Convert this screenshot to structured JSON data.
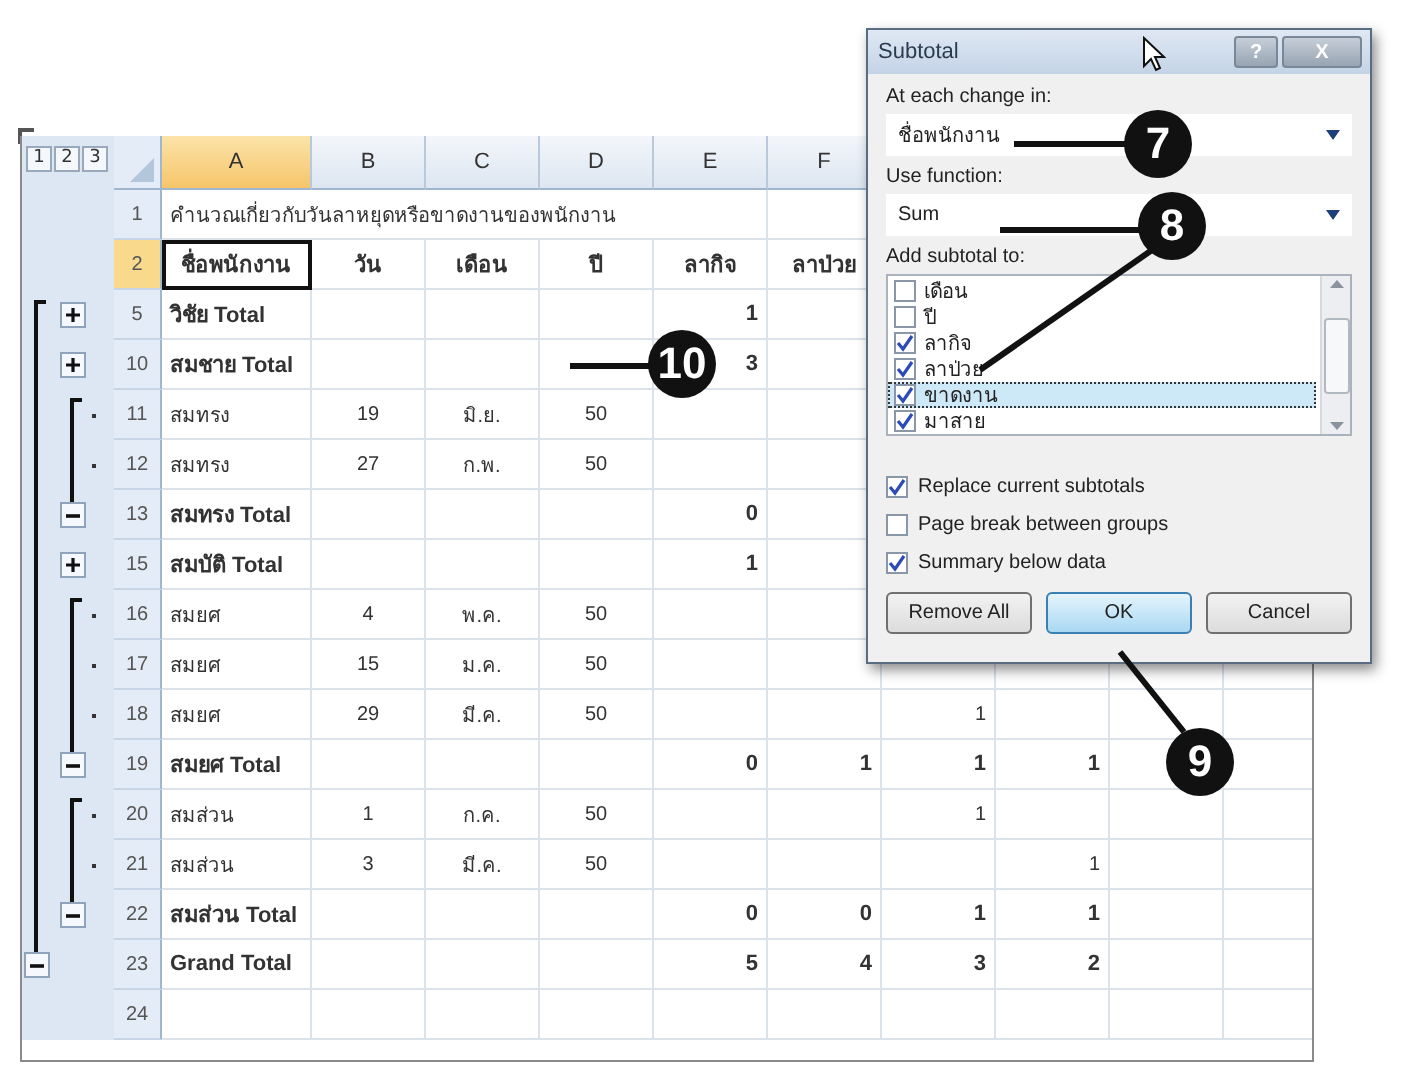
{
  "outline_levels": [
    "1",
    "2",
    "3"
  ],
  "columns": [
    {
      "label": "A",
      "selected": true
    },
    {
      "label": "B",
      "selected": false
    },
    {
      "label": "C",
      "selected": false
    },
    {
      "label": "D",
      "selected": false
    },
    {
      "label": "E",
      "selected": false
    },
    {
      "label": "F",
      "selected": false
    }
  ],
  "rows": [
    {
      "number": "1",
      "kind": "title",
      "selected": false,
      "cells": [
        "คำนวณเกี่ยวกับวันลาหยุดหรือขาดงานของพนักงาน"
      ]
    },
    {
      "number": "2",
      "kind": "header",
      "selected": true,
      "cells": [
        "ชื่อพนักงาน",
        "วัน",
        "เดือน",
        "ปี",
        "ลากิจ",
        "ลาป่วย"
      ]
    },
    {
      "number": "5",
      "kind": "total",
      "selected": false,
      "outline": {
        "kind": "expand"
      },
      "cells": [
        "วิชัย Total",
        null,
        null,
        null,
        "1"
      ]
    },
    {
      "number": "10",
      "kind": "total",
      "selected": false,
      "outline": {
        "kind": "expand"
      },
      "cells": [
        "สมชาย Total",
        null,
        null,
        null,
        "3"
      ]
    },
    {
      "number": "11",
      "kind": "detail",
      "selected": false,
      "outline": {
        "kind": "detail"
      },
      "cells": [
        "สมทรง",
        "19",
        "มิ.ย.",
        "50"
      ]
    },
    {
      "number": "12",
      "kind": "detail",
      "selected": false,
      "outline": {
        "kind": "detail"
      },
      "cells": [
        "สมทรง",
        "27",
        "ก.พ.",
        "50"
      ]
    },
    {
      "number": "13",
      "kind": "total",
      "selected": false,
      "outline": {
        "kind": "collapse"
      },
      "cells": [
        "สมทรง Total",
        null,
        null,
        null,
        "0"
      ]
    },
    {
      "number": "15",
      "kind": "total",
      "selected": false,
      "outline": {
        "kind": "expand"
      },
      "cells": [
        "สมบัติ Total",
        null,
        null,
        null,
        "1"
      ]
    },
    {
      "number": "16",
      "kind": "detail",
      "selected": false,
      "outline": {
        "kind": "detail"
      },
      "cells": [
        "สมยศ",
        "4",
        "พ.ค.",
        "50"
      ]
    },
    {
      "number": "17",
      "kind": "detail",
      "selected": false,
      "outline": {
        "kind": "detail"
      },
      "cells": [
        "สมยศ",
        "15",
        "ม.ค.",
        "50"
      ]
    },
    {
      "number": "18",
      "kind": "detail",
      "selected": false,
      "outline": {
        "kind": "detail"
      },
      "cells": [
        "สมยศ",
        "29",
        "มี.ค.",
        "50",
        null,
        null,
        "1"
      ]
    },
    {
      "number": "19",
      "kind": "total",
      "selected": false,
      "outline": {
        "kind": "collapse"
      },
      "cells": [
        "สมยศ Total",
        null,
        null,
        null,
        "0",
        "1",
        "1",
        "1"
      ]
    },
    {
      "number": "20",
      "kind": "detail",
      "selected": false,
      "outline": {
        "kind": "detail"
      },
      "cells": [
        "สมส่วน",
        "1",
        "ก.ค.",
        "50",
        null,
        null,
        "1"
      ]
    },
    {
      "number": "21",
      "kind": "detail",
      "selected": false,
      "outline": {
        "kind": "detail"
      },
      "cells": [
        "สมส่วน",
        "3",
        "มี.ค.",
        "50",
        null,
        null,
        null,
        "1"
      ]
    },
    {
      "number": "22",
      "kind": "total",
      "selected": false,
      "outline": {
        "kind": "collapse"
      },
      "cells": [
        "สมส่วน Total",
        null,
        null,
        null,
        "0",
        "0",
        "1",
        "1"
      ]
    },
    {
      "number": "23",
      "kind": "total",
      "selected": false,
      "outline": {
        "kind": "collapse_outer"
      },
      "cells": [
        "Grand Total",
        null,
        null,
        null,
        "5",
        "4",
        "3",
        "2"
      ]
    },
    {
      "number": "24",
      "kind": "empty",
      "selected": false,
      "cells": []
    }
  ],
  "dialog": {
    "title": "Subtotal",
    "help": "?",
    "close": "X",
    "change_label": "At each change in:",
    "change_value": "ชื่อพนักงาน",
    "function_label": "Use function:",
    "function_value": "Sum",
    "add_label": "Add subtotal to:",
    "add_items": [
      {
        "label": "เดือน",
        "checked": false,
        "selected": false
      },
      {
        "label": "ปี",
        "checked": false,
        "selected": false
      },
      {
        "label": "ลากิจ",
        "checked": true,
        "selected": false
      },
      {
        "label": "ลาป่วย",
        "checked": true,
        "selected": false
      },
      {
        "label": "ขาดงาน",
        "checked": true,
        "selected": true
      },
      {
        "label": "มาสาย",
        "checked": true,
        "selected": false
      }
    ],
    "options": [
      {
        "label": "Replace current subtotals",
        "checked": true
      },
      {
        "label": "Page break between groups",
        "checked": false
      },
      {
        "label": "Summary below data",
        "checked": true
      }
    ],
    "buttons": [
      {
        "label": "Remove All",
        "default": false
      },
      {
        "label": "OK",
        "default": true
      },
      {
        "label": "Cancel",
        "default": false
      }
    ]
  },
  "callouts": [
    {
      "label": "7"
    },
    {
      "label": "8"
    },
    {
      "label": "9"
    },
    {
      "label": "10"
    }
  ]
}
